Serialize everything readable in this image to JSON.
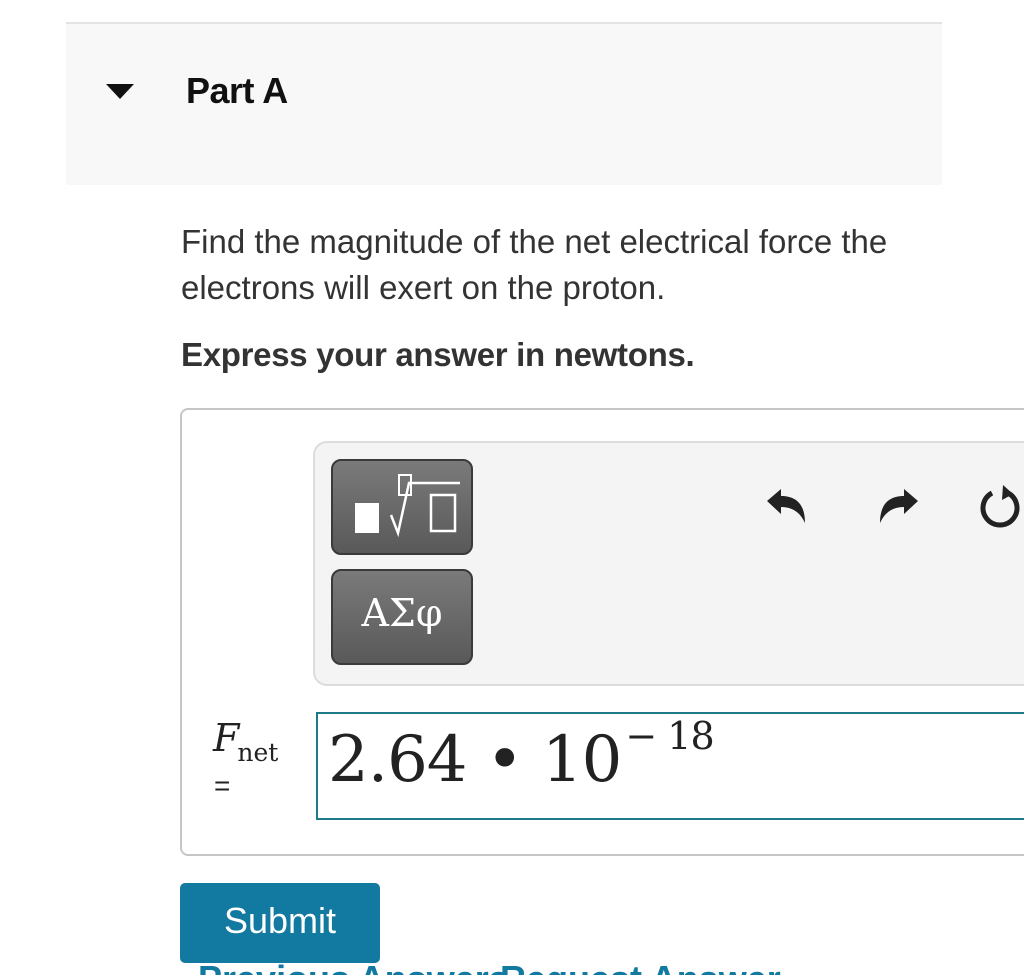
{
  "part": {
    "title": "Part A",
    "caret_icon": "caret-down-icon"
  },
  "question": {
    "text": "Find the magnitude of the net electrical force the electrons will exert on the proton.",
    "instruction": "Express your answer in newtons."
  },
  "toolbar": {
    "templates_icon": "templates-sqrt-icon",
    "symbols_label": "ΑΣφ",
    "undo_icon": "undo-icon",
    "redo_icon": "redo-icon",
    "reset_icon": "reset-icon"
  },
  "answer": {
    "variable": "F",
    "subscript": "net",
    "equals": "=",
    "mantissa": "2.64 • 10",
    "exponent": "− 18"
  },
  "actions": {
    "submit_label": "Submit",
    "review_link": "Previous Answers",
    "request_link": "Request Answer"
  },
  "colors": {
    "header_bg": "#f8f8f8",
    "accent": "#1279a0",
    "input_border": "#1d7a86",
    "tool_button": "#6a6a6a"
  }
}
